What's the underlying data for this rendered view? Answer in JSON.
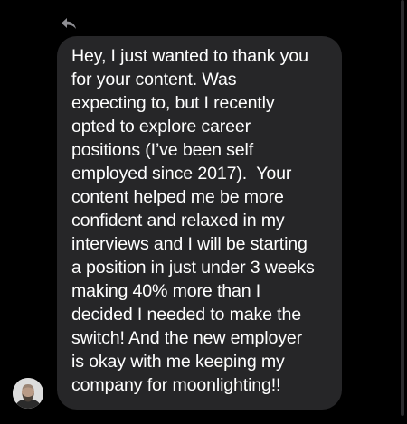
{
  "conversation": {
    "message": {
      "lines": [
        "Hey, I just wanted to thank you",
        "for your content. Was",
        "expecting to, but I recently",
        "opted to explore career",
        "positions (I’ve been self",
        "employed since 2017).  Your",
        "content helped me be more",
        "confident and relaxed in my",
        "interviews and I will be starting",
        "a position in just under 3 weeks",
        "making 40% more than I",
        "decided I needed to make the",
        "switch! And the new employer",
        "is okay with me keeping my",
        "company for moonlighting!!"
      ]
    },
    "icons": {
      "reply": "reply-arrow-icon",
      "avatar": "sender-avatar"
    }
  },
  "colors": {
    "background": "#000000",
    "bubble": "#262628",
    "text": "#ffffff",
    "icon": "#8e8e93"
  }
}
